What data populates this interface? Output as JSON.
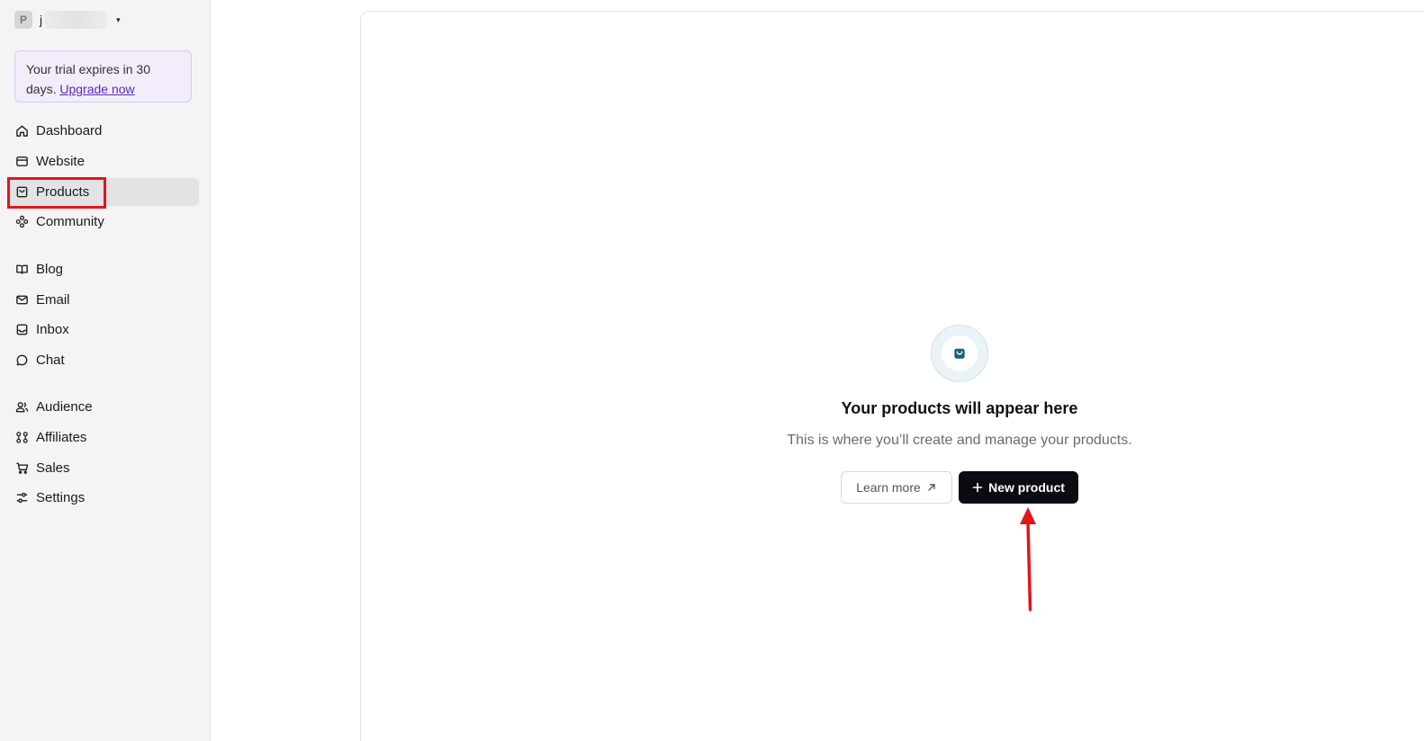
{
  "workspace": {
    "avatar_letter": "P",
    "name_prefix": "j",
    "caret": "▾"
  },
  "trial": {
    "text": "Your trial expires in 30 days.",
    "link_label": "Upgrade now"
  },
  "sidebar": {
    "items": [
      {
        "label": "Dashboard",
        "icon": "home-icon"
      },
      {
        "label": "Website",
        "icon": "browser-icon"
      },
      {
        "label": "Products",
        "icon": "bag-icon",
        "active": true
      },
      {
        "label": "Community",
        "icon": "community-icon"
      },
      {
        "label": "Blog",
        "icon": "book-icon"
      },
      {
        "label": "Email",
        "icon": "mail-icon"
      },
      {
        "label": "Inbox",
        "icon": "inbox-icon"
      },
      {
        "label": "Chat",
        "icon": "chat-icon"
      },
      {
        "label": "Audience",
        "icon": "users-icon"
      },
      {
        "label": "Affiliates",
        "icon": "affiliates-icon"
      },
      {
        "label": "Sales",
        "icon": "cart-icon"
      },
      {
        "label": "Settings",
        "icon": "sliders-icon"
      }
    ]
  },
  "main": {
    "empty_icon": "bag-icon",
    "title": "Your products will appear here",
    "subtitle": "This is where you’ll create and manage your products.",
    "learn_more_label": "Learn more",
    "new_product_label": "New product"
  },
  "colors": {
    "accent_highlight": "#e3151b",
    "primary_button": "#0b0b12",
    "trial_bg": "#f2ecfb",
    "icon_blue": "#1f5f86"
  }
}
